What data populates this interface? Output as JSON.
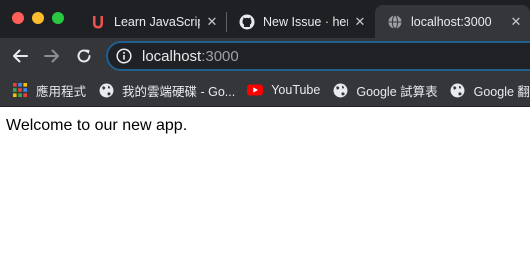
{
  "colors": {
    "tab_strip": "#1f2023",
    "toolbar": "#35363a",
    "omnibox_bg": "#202124",
    "omnibox_focus": "#1e5f8f",
    "text": "#e8eaed",
    "text_dim": "#9aa0a6",
    "traffic_close": "#ff5f57",
    "traffic_minimize": "#febc2e",
    "traffic_maximize": "#28c840"
  },
  "tabs": [
    {
      "title": "Learn JavaScript",
      "icon": "udemy-icon",
      "active": false
    },
    {
      "title": "New Issue · her",
      "icon": "github-icon",
      "active": false
    },
    {
      "title": "localhost:3000",
      "icon": "globe-icon",
      "active": true
    }
  ],
  "toolbar": {
    "url_host": "localhost",
    "url_port": ":3000"
  },
  "bookmarks": [
    {
      "label": "應用程式",
      "icon": "apps-grid-icon"
    },
    {
      "label": "我的雲端硬碟 - Go...",
      "icon": "globe-icon"
    },
    {
      "label": "YouTube",
      "icon": "youtube-icon"
    },
    {
      "label": "Google 試算表",
      "icon": "globe-icon"
    },
    {
      "label": "Google 翻",
      "icon": "globe-icon"
    }
  ],
  "page": {
    "message": "Welcome to our new app."
  }
}
